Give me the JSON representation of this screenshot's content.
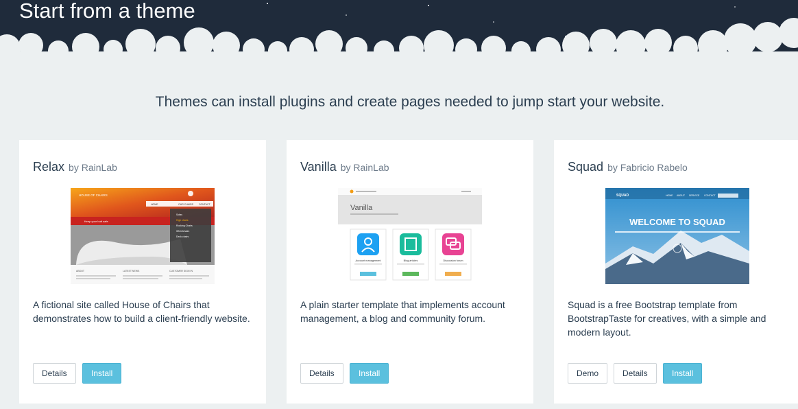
{
  "hero": {
    "title": "Start from a theme"
  },
  "subtitle": "Themes can install plugins and create pages needed to jump start your website.",
  "colors": {
    "hero_bg": "#1f2b3b",
    "card_bg": "#ffffff",
    "page_bg": "#ecf0f1",
    "install_button": "#5bc0de"
  },
  "themes": [
    {
      "name": "Relax",
      "author": "by RainLab",
      "description": "A fictional site called House of Chairs that demonstrates how to build a client-friendly website.",
      "details_label": "Details",
      "install_label": "Install"
    },
    {
      "name": "Vanilla",
      "author": "by RainLab",
      "description": "A plain starter template that implements account management, a blog and community forum.",
      "details_label": "Details",
      "install_label": "Install"
    },
    {
      "name": "Squad",
      "author": "by Fabricio Rabelo",
      "description": "Squad is a free Bootstrap template from BootstrapTaste for creatives, with a simple and modern layout.",
      "demo_label": "Demo",
      "details_label": "Details",
      "install_label": "Install"
    }
  ],
  "thumbnails": {
    "relax": {
      "logo": "HOUSE OF CHAIRS",
      "nav": [
        "HOME",
        "OUR CHAIRS",
        "CONTACT"
      ],
      "banner": "Keep your butt safe",
      "menu": [
        "Sofas",
        "High chairs",
        "Rocking Chairs",
        "Wheelchairs",
        "Deck chairs"
      ],
      "columns": [
        "ABOUT",
        "LATEST NEWS",
        "CUSTOMER SIGN IN"
      ]
    },
    "vanilla": {
      "heading": "Vanilla",
      "features": [
        "Account management",
        "Blog articles",
        "Discussion forum"
      ]
    },
    "squad": {
      "brand": "SQUAD",
      "nav": [
        "HOME",
        "ABOUT",
        "SERVICE",
        "CONTACT"
      ],
      "headline": "WELCOME TO SQUAD"
    }
  }
}
